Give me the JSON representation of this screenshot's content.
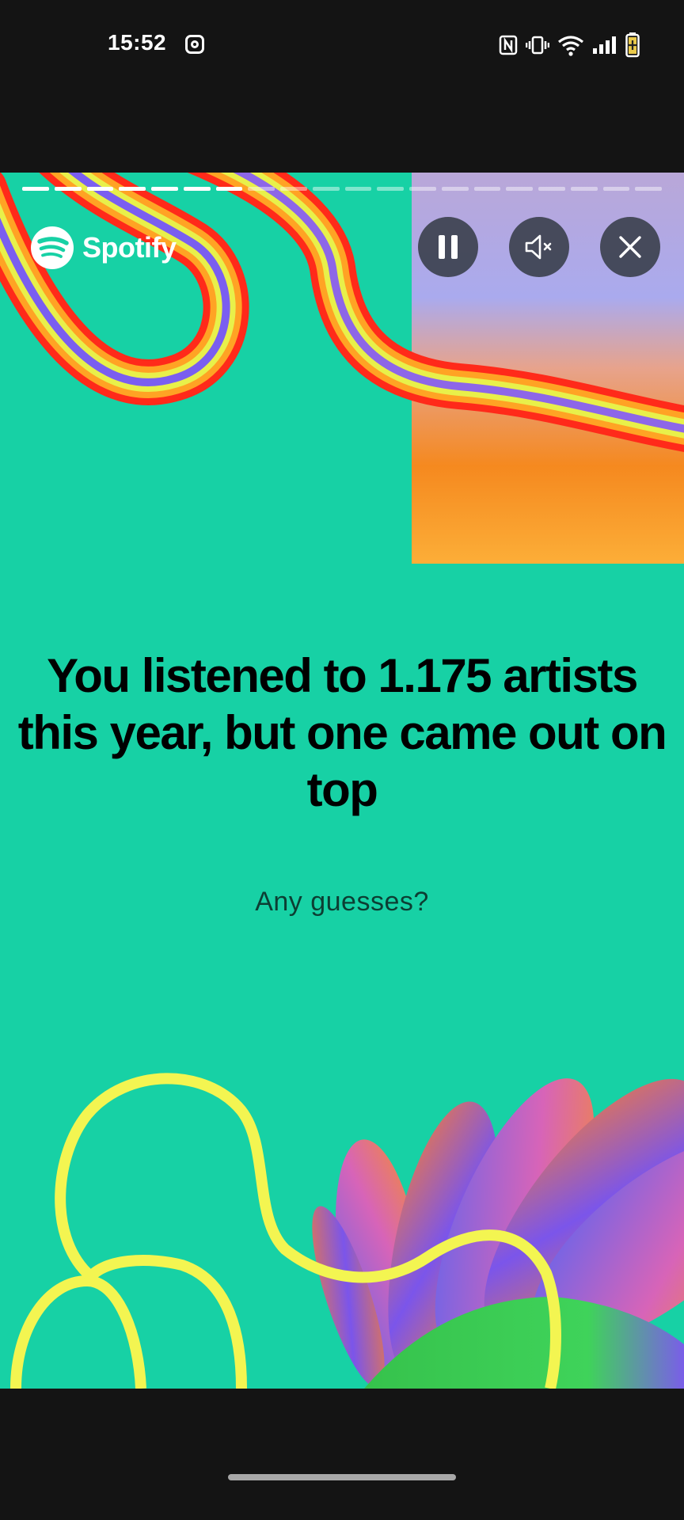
{
  "status_bar": {
    "time": "15:52",
    "icons": [
      "instagram-icon",
      "nfc-icon",
      "vibrate-icon",
      "wifi-icon",
      "signal-icon",
      "battery-icon"
    ]
  },
  "story": {
    "brand": "Spotify",
    "progress": {
      "segments_total": 20,
      "segments_completed": 7
    },
    "controls": {
      "pause": "pause-icon",
      "mute": "speaker-muted-icon",
      "close": "close-icon"
    },
    "headline": "You listened to 1.175 artists this year, but one came out on top",
    "subtitle": "Any guesses?",
    "colors": {
      "background": "#17d1a5",
      "headline": "#000000",
      "accent_yellow": "#f3f551"
    }
  },
  "system": {
    "home_indicator": "home-indicator"
  }
}
